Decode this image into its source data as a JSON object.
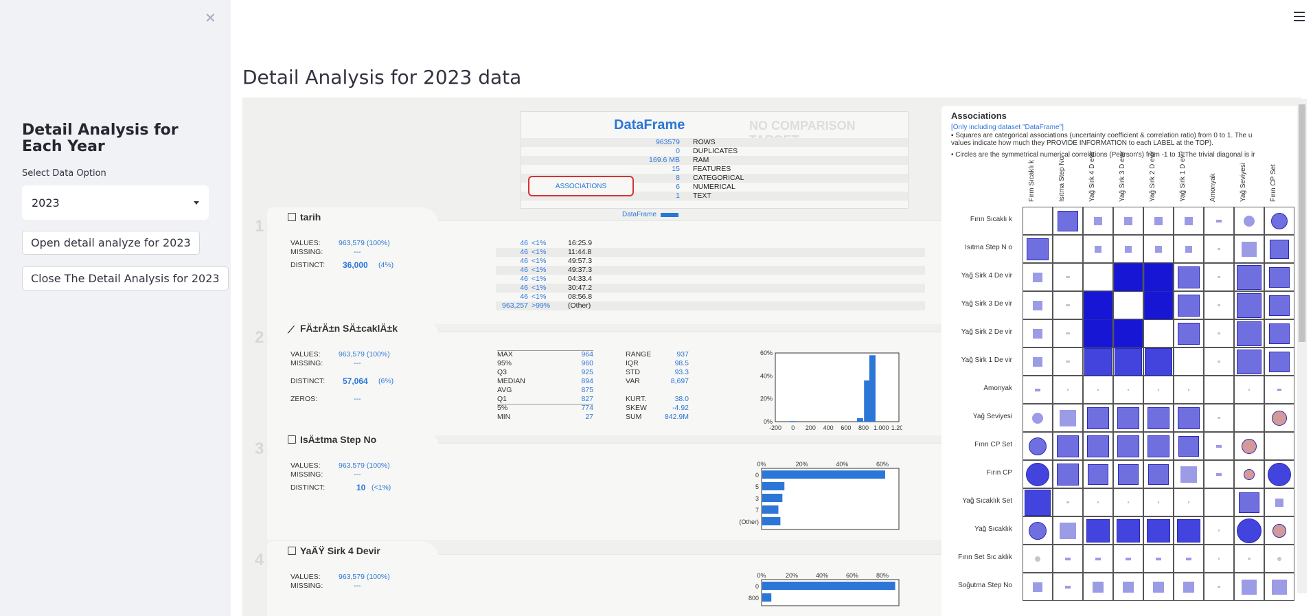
{
  "sidebar": {
    "close_icon": "close-icon",
    "title": "Detail Analysis for Each Year",
    "select_label": "Select Data Option",
    "select_value": "2023",
    "open_button": "Open detail analyze for 2023",
    "close_button": "Close The Detail Analysis for 2023"
  },
  "header": {
    "menu_icon": "hamburger-icon"
  },
  "main": {
    "title": "Detail Analysis for 2023 data"
  },
  "report": {
    "summary": {
      "title": "DataFrame",
      "comparison": "NO COMPARISON TARGET",
      "rows": [
        {
          "value": "963579",
          "label": "ROWS"
        },
        {
          "value": "0",
          "label": "DUPLICATES"
        },
        {
          "value": "169.6 MB",
          "label": "RAM"
        },
        {
          "value": "15",
          "label": "FEATURES"
        },
        {
          "value": "8",
          "label": "CATEGORICAL"
        },
        {
          "value": "6",
          "label": "NUMERICAL"
        },
        {
          "value": "1",
          "label": "TEXT"
        }
      ],
      "associations_button": "ASSOCIATIONS",
      "legend": "DataFrame"
    },
    "features": [
      {
        "num": "1",
        "name": "tarih",
        "icon": "text-icon",
        "values_k": "VALUES:",
        "values_v": "963,579 (100%)",
        "missing_k": "MISSING:",
        "missing_v": "---",
        "distinct_k": "DISTINCT:",
        "distinct_v": "36,000",
        "distinct_p": "(4%)",
        "freq": [
          {
            "c": "46",
            "p": "<1%",
            "t": "16:25.9"
          },
          {
            "c": "46",
            "p": "<1%",
            "t": "11:44.8"
          },
          {
            "c": "46",
            "p": "<1%",
            "t": "49:57.3"
          },
          {
            "c": "46",
            "p": "<1%",
            "t": "49:37.3"
          },
          {
            "c": "46",
            "p": "<1%",
            "t": "04:33.4"
          },
          {
            "c": "46",
            "p": "<1%",
            "t": "30:47.2"
          },
          {
            "c": "46",
            "p": "<1%",
            "t": "08:56.8"
          },
          {
            "c": "963,257",
            "p": ">99%",
            "t": "(Other)"
          }
        ]
      },
      {
        "num": "2",
        "name": "FÄ±rÄ±n SÄ±caklÄ±k",
        "icon": "line-chart-icon",
        "values_k": "VALUES:",
        "values_v": "963,579 (100%)",
        "missing_k": "MISSING:",
        "missing_v": "---",
        "distinct_k": "DISTINCT:",
        "distinct_v": "57,064",
        "distinct_p": "(6%)",
        "zeros_k": "ZEROS:",
        "zeros_v": "---",
        "quantiles": [
          {
            "k": "MAX",
            "v": "964"
          },
          {
            "k": "95%",
            "v": "960"
          },
          {
            "k": "Q3",
            "v": "925"
          },
          {
            "k": "MEDIAN",
            "v": "894"
          },
          {
            "k": "AVG",
            "v": "875"
          },
          {
            "k": "Q1",
            "v": "827"
          },
          {
            "k": "5%",
            "v": "774"
          },
          {
            "k": "MIN",
            "v": "27"
          }
        ],
        "stats": [
          {
            "k": "RANGE",
            "v": "937"
          },
          {
            "k": "IQR",
            "v": "98.5"
          },
          {
            "k": "STD",
            "v": "93.3"
          },
          {
            "k": "VAR",
            "v": "8,697"
          },
          {
            "k": "",
            "v": ""
          },
          {
            "k": "KURT.",
            "v": "38.0"
          },
          {
            "k": "SKEW",
            "v": "-4.92"
          },
          {
            "k": "SUM",
            "v": "842.9M"
          }
        ]
      },
      {
        "num": "3",
        "name": "IsÄ±tma Step No",
        "icon": "category-icon",
        "values_k": "VALUES:",
        "values_v": "963,579 (100%)",
        "missing_k": "MISSING:",
        "missing_v": "---",
        "distinct_k": "DISTINCT:",
        "distinct_v": "10",
        "distinct_p": "(<1%)"
      },
      {
        "num": "4",
        "name": "YaÄŸ Sirk 4 Devir",
        "icon": "category-icon",
        "values_k": "VALUES:",
        "values_v": "963,579 (100%)",
        "missing_k": "MISSING:",
        "missing_v": "---",
        "distinct_k": "DISTINCT:",
        "distinct_v": "",
        "distinct_p": ""
      }
    ],
    "associations": {
      "title": "Associations",
      "note": "[Only including dataset \"DataFrame\"]",
      "line1": "▪ Squares are categorical associations (uncertainty coefficient & correlation ratio) from 0 to 1. The u",
      "line2": "values indicate how much they PROVIDE INFORMATION to each LABEL at the TOP).",
      "line3": "• Circles are the symmetrical numerical correlations (Pearson's) from -1 to 1. The trivial diagonal is ir",
      "columns": [
        "Fırın Sıcaklı k",
        "Isıtma Step No",
        "Yağ Sirk 4 D evir",
        "Yağ Sirk 3 D evir",
        "Yağ Sirk 2 D evir",
        "Yağ Sirk 1 D evir",
        "Amonyak",
        "Yağ Seviyesi",
        "Fırın CP Set"
      ],
      "rows": [
        "Fırın Sıcaklı k",
        "Isıtma Step N o",
        "Yağ Sirk 4 De vir",
        "Yağ Sirk 3 De vir",
        "Yağ Sirk 2 De vir",
        "Yağ Sirk 1 De vir",
        "Amonyak",
        "Yağ Seviyesi",
        "Fırın CP Set",
        "Fırın CP",
        "Yağ Sıcaklık Set",
        "Yağ Sıcaklık",
        "Fırın Set Sıc aklık",
        "Soğutma Step No"
      ]
    }
  },
  "chart_data": [
    {
      "type": "bar",
      "title": "",
      "x_ticks": [
        "-200",
        "0",
        "200",
        "400",
        "600",
        "800",
        "1,000",
        "1,200"
      ],
      "y_ticks": [
        "0%",
        "20%",
        "40%",
        "60%"
      ],
      "bins_center": [
        0,
        760,
        840,
        900
      ],
      "values_pct": [
        0.5,
        3,
        36,
        58
      ],
      "xlim": [
        -200,
        1200
      ],
      "ylim": [
        0,
        60
      ]
    },
    {
      "type": "bar",
      "orientation": "horizontal",
      "categories": [
        "0",
        "5",
        "3",
        "7",
        "(Other)"
      ],
      "values_pct": [
        61,
        11,
        10,
        8,
        9
      ],
      "x_ticks": [
        "0%",
        "20%",
        "40%",
        "60%"
      ],
      "xlim": [
        0,
        60
      ]
    },
    {
      "type": "bar",
      "orientation": "horizontal",
      "categories": [
        "0",
        "800"
      ],
      "values_pct": [
        88,
        6
      ],
      "x_ticks": [
        "0%",
        "20%",
        "40%",
        "60%",
        "80%"
      ],
      "xlim": [
        0,
        80
      ]
    }
  ]
}
